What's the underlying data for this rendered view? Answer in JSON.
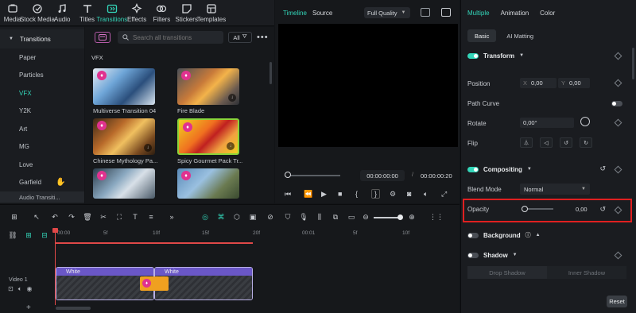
{
  "toolbar": {
    "items": [
      {
        "label": "Media",
        "icon": "media-icon"
      },
      {
        "label": "Stock Media",
        "icon": "stock-media-icon"
      },
      {
        "label": "Audio",
        "icon": "audio-icon"
      },
      {
        "label": "Titles",
        "icon": "titles-icon"
      },
      {
        "label": "Transitions",
        "icon": "transitions-icon",
        "active": true
      },
      {
        "label": "Effects",
        "icon": "effects-icon"
      },
      {
        "label": "Filters",
        "icon": "filters-icon"
      },
      {
        "label": "Stickers",
        "icon": "stickers-icon"
      },
      {
        "label": "Templates",
        "icon": "templates-icon"
      }
    ]
  },
  "sidebar": {
    "header": "Transitions",
    "items": [
      "Paper",
      "Particles",
      "VFX",
      "Y2K",
      "Art",
      "MG",
      "Love",
      "Garfield"
    ],
    "active": "VFX",
    "footer": "Audio Transiti..."
  },
  "library": {
    "search_placeholder": "Search all transitions",
    "filter_label": "All",
    "section": "VFX",
    "items": [
      {
        "label": "Multiverse Transition 04"
      },
      {
        "label": "Fire Blade"
      },
      {
        "label": "Chinese Mythology Pa..."
      },
      {
        "label": "Spicy Gourmet Pack Tr..."
      }
    ]
  },
  "player": {
    "tab_timeline": "Timeline",
    "tab_source": "Source",
    "quality": "Full Quality",
    "current_time": "00:00:00:00",
    "separator": "/",
    "total_time": "00:00:00:20"
  },
  "panel": {
    "tabs": [
      "Multiple",
      "Animation",
      "Color"
    ],
    "subtabs": [
      "Basic",
      "AI Matting"
    ],
    "transform": {
      "title": "Transform",
      "position_label": "Position",
      "x_axis": "X",
      "x_value": "0,00",
      "y_axis": "Y",
      "y_value": "0,00",
      "path_curve_label": "Path Curve",
      "rotate_label": "Rotate",
      "rotate_value": "0,00°",
      "flip_label": "Flip"
    },
    "compositing": {
      "title": "Compositing",
      "blend_mode_label": "Blend Mode",
      "blend_mode_value": "Normal",
      "opacity_label": "Opacity",
      "opacity_value": "0,00",
      "opacity_level": 0.0
    },
    "background_label": "Background",
    "shadow": {
      "title": "Shadow",
      "drop_shadow": "Drop Shadow",
      "inner_shadow": "Inner Shadow"
    },
    "reset_label": "Reset"
  },
  "timeline": {
    "ruler": [
      "00:00",
      "5f",
      "10f",
      "15f",
      "20f",
      "00:01",
      "5f",
      "10f"
    ],
    "track_label": "Video 1",
    "clips": [
      {
        "label": "White"
      },
      {
        "label": "White"
      }
    ]
  },
  "colors": {
    "accent": "#33d6b9",
    "highlight_border": "#e02020",
    "clip_purple": "#6a57c7",
    "transition_orange": "#f0a020"
  }
}
